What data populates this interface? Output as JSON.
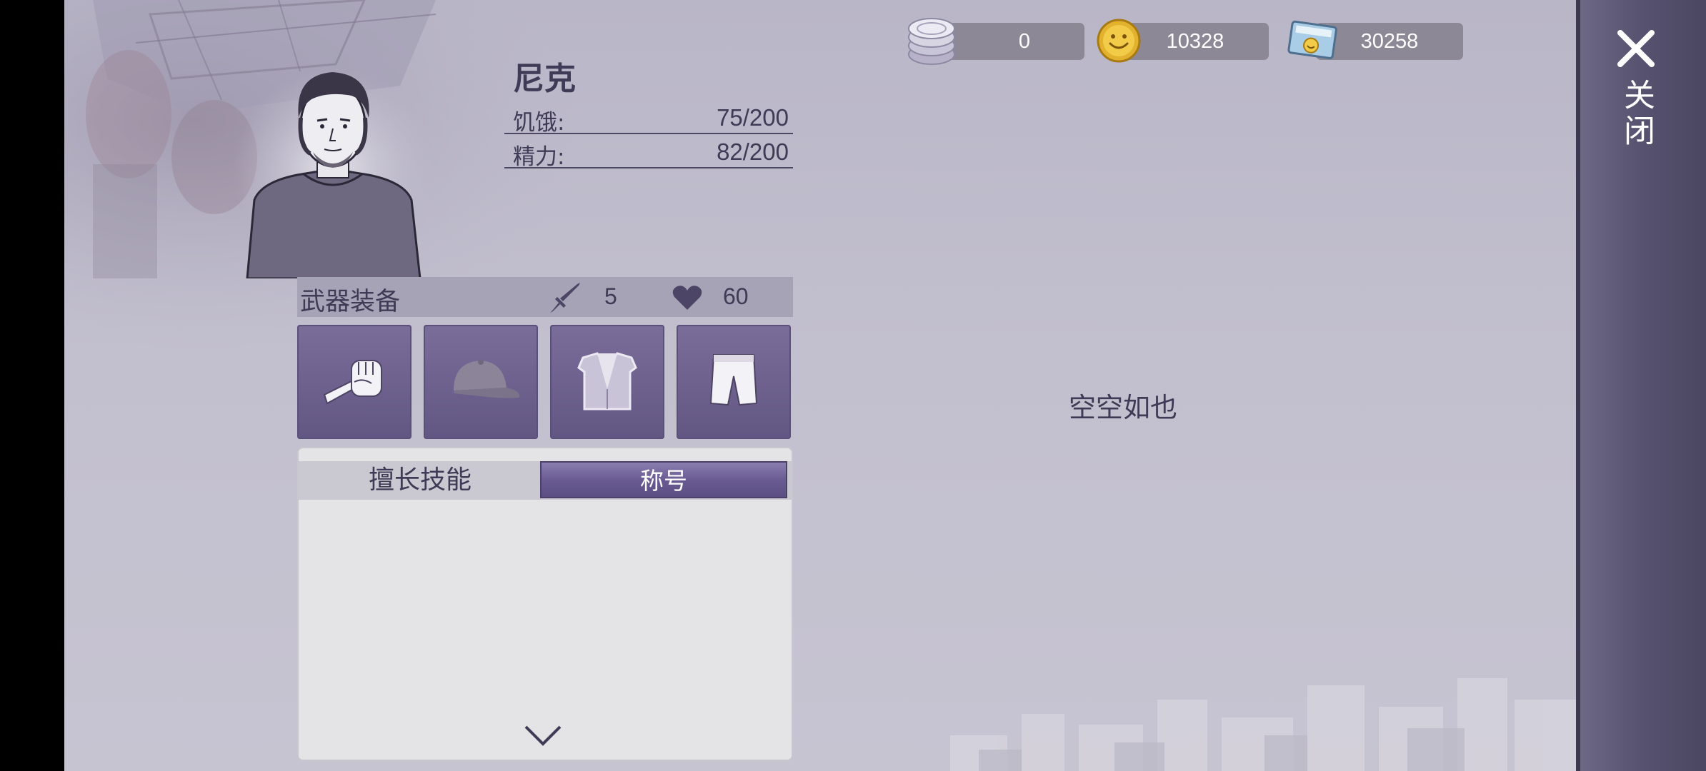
{
  "currencies": [
    {
      "icon": "silver-coin-stack-icon",
      "value": "0"
    },
    {
      "icon": "gold-smiley-coin-icon",
      "value": "10328"
    },
    {
      "icon": "ticket-icon",
      "value": "30258"
    }
  ],
  "close": {
    "label": "关闭"
  },
  "character": {
    "name": "尼克",
    "stats": [
      {
        "label": "饥饿:",
        "value": "75/200"
      },
      {
        "label": "精力:",
        "value": "82/200"
      }
    ]
  },
  "equipment": {
    "title": "武器装备",
    "attack": "5",
    "health": "60",
    "slots": [
      "fist-icon",
      "cap-icon",
      "vest-icon",
      "shorts-icon"
    ]
  },
  "skills": {
    "tab_skills": "擅长技能",
    "tab_titles": "称号",
    "active_tab": "称号"
  },
  "content": {
    "empty_text": "空空如也"
  },
  "colors": {
    "accent": "#6a5c93",
    "text": "#3f3a55",
    "panel": "#57526f"
  }
}
